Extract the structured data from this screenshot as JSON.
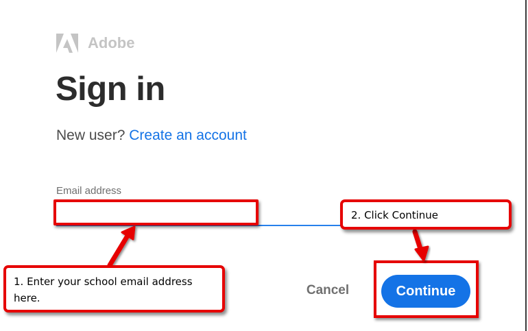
{
  "brand": {
    "name": "Adobe",
    "logo_icon": "adobe-logo-icon",
    "logo_color": "#c4c4c4"
  },
  "page": {
    "title": "Sign in",
    "new_user_prompt": "New user?",
    "create_account_link": "Create an account"
  },
  "form": {
    "email_label": "Email address",
    "email_value": "",
    "email_placeholder": ""
  },
  "actions": {
    "cancel_label": "Cancel",
    "continue_label": "Continue"
  },
  "annotations": {
    "step1_text": "1. Enter your school email address here.",
    "step2_text": "2. Click Continue",
    "highlight_color": "#e60000"
  },
  "colors": {
    "accent": "#1473e6",
    "title": "#2c2c2c",
    "input_underline": "#2680eb"
  }
}
